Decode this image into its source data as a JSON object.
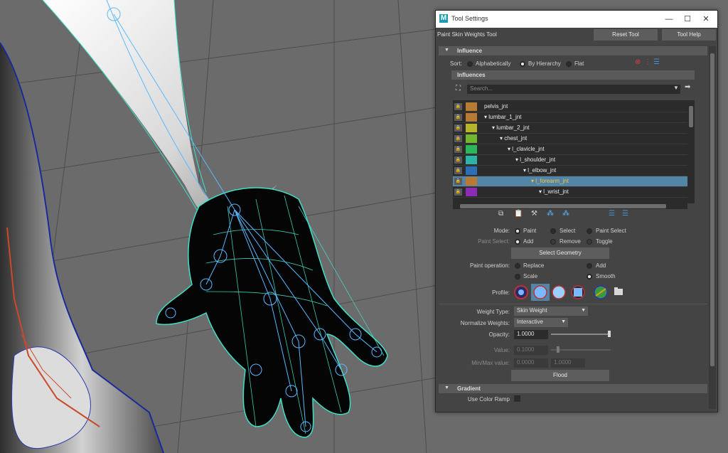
{
  "window": {
    "title": "Tool Settings",
    "tool_name": "Paint Skin Weights Tool",
    "reset_label": "Reset Tool",
    "help_label": "Tool Help",
    "minimize_glyph": "—",
    "maximize_glyph": "☐",
    "close_glyph": "✕"
  },
  "influence": {
    "header": "Influence",
    "sort_label": "Sort:",
    "sort_options": [
      "Alphabetically",
      "By Hierarchy",
      "Flat"
    ],
    "sort_selected": "By Hierarchy",
    "influences_header": "Influences",
    "search_placeholder": "Search...",
    "joints": [
      {
        "name": "pelvis_jnt",
        "depth": 0,
        "color": "#b87a32",
        "selected": false
      },
      {
        "name": "lumbar_1_jnt",
        "depth": 0,
        "color": "#b87a32",
        "selected": false
      },
      {
        "name": "lumbar_2_jnt",
        "depth": 1,
        "color": "#b5b42c",
        "selected": false
      },
      {
        "name": "chest_jnt",
        "depth": 2,
        "color": "#73b52c",
        "selected": false
      },
      {
        "name": "l_clavicle_jnt",
        "depth": 3,
        "color": "#2cb55a",
        "selected": false
      },
      {
        "name": "l_shoulder_jnt",
        "depth": 4,
        "color": "#2cb5a6",
        "selected": false
      },
      {
        "name": "l_elbow_jnt",
        "depth": 5,
        "color": "#2c6fb5",
        "selected": false
      },
      {
        "name": "l_forearm_jnt",
        "depth": 6,
        "color": "#b87a32",
        "selected": true
      },
      {
        "name": "l_wrist_jnt",
        "depth": 7,
        "color": "#8a2cb5",
        "selected": false
      }
    ]
  },
  "paint": {
    "mode_label": "Mode:",
    "mode_options": [
      "Paint",
      "Select",
      "Paint Select"
    ],
    "mode_selected": "Paint",
    "paint_select_label": "Paint Select:",
    "paint_select_options": [
      "Add",
      "Remove",
      "Toggle"
    ],
    "select_geometry_label": "Select Geometry",
    "operation_label": "Paint operation:",
    "operation_options": [
      "Replace",
      "Add",
      "Scale",
      "Smooth"
    ],
    "operation_selected": "Smooth",
    "profile_label": "Profile:",
    "weight_type_label": "Weight Type:",
    "weight_type_value": "Skin Weight",
    "normalize_label": "Normalize Weights:",
    "normalize_value": "Interactive",
    "opacity_label": "Opacity:",
    "opacity_value": "1.0000",
    "opacity_fraction": 1.0,
    "value_label": "Value:",
    "value_value": "0.1000",
    "value_fraction": 0.1,
    "minmax_label": "Min/Max value:",
    "min_value": "0.0000",
    "max_value": "1.0000",
    "flood_label": "Flood"
  },
  "gradient": {
    "header": "Gradient",
    "use_color_ramp_label": "Use Color Ramp"
  },
  "colors": {
    "wireframe": "#3fe0c8",
    "skeleton": "#c94a2a",
    "selection": "#5285a6",
    "accent_logo": "#1d9bb0"
  }
}
